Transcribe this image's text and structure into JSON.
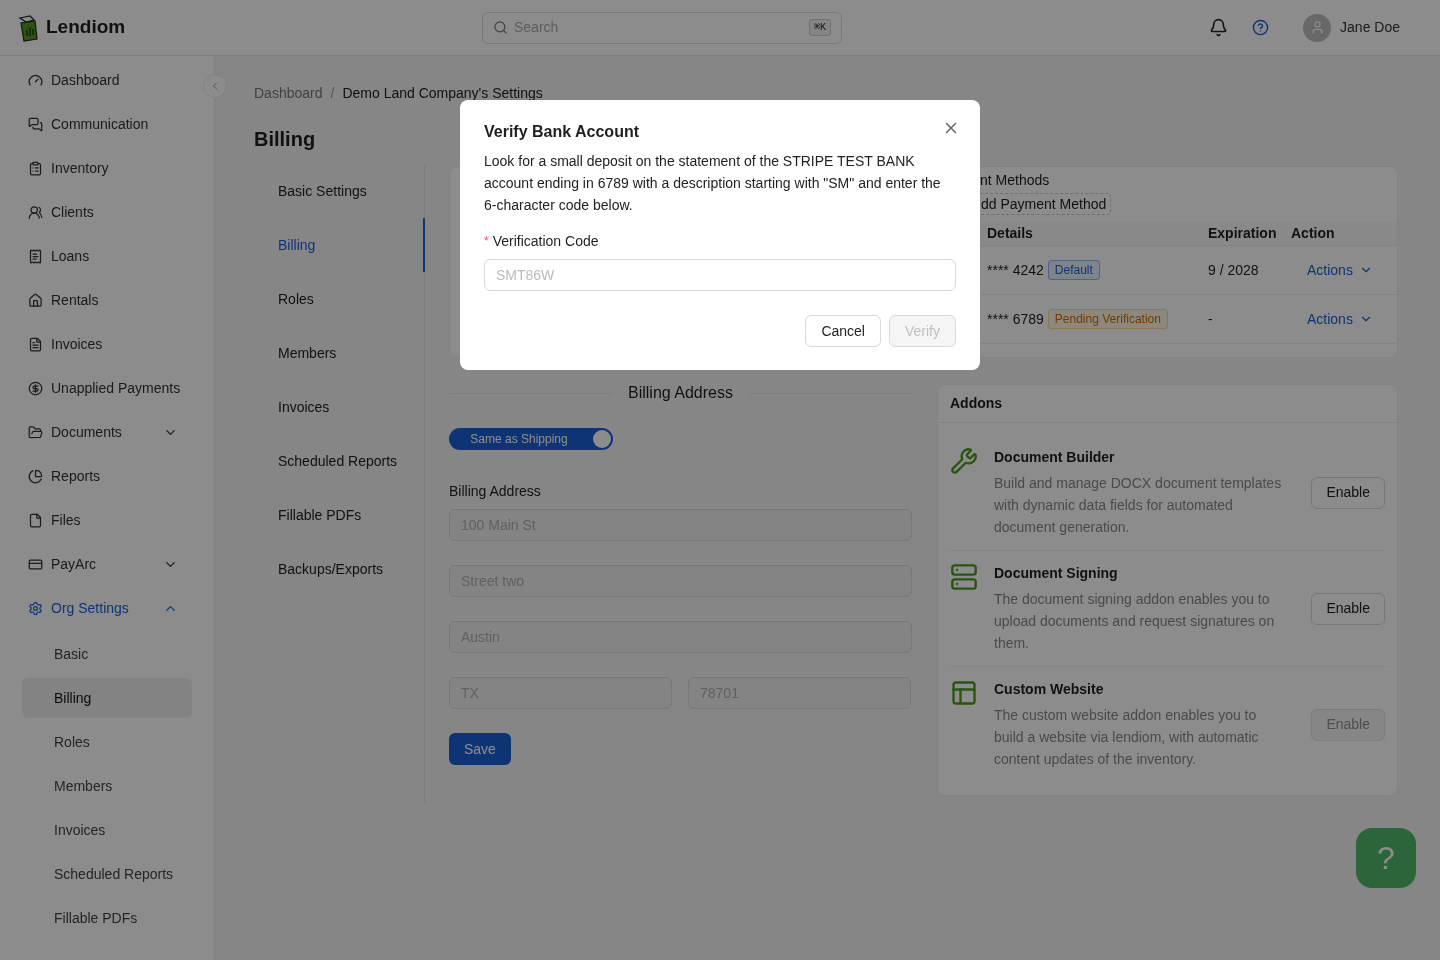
{
  "app": {
    "name": "Lendiom"
  },
  "header": {
    "search": {
      "placeholder": "Search",
      "shortcut": "⌘K"
    },
    "user": {
      "name": "Jane Doe"
    }
  },
  "sidebar": {
    "items": [
      {
        "label": "Dashboard",
        "kind": "link",
        "selected": false
      },
      {
        "label": "Communication",
        "kind": "link",
        "selected": false
      },
      {
        "label": "Inventory",
        "kind": "link",
        "selected": false
      },
      {
        "label": "Clients",
        "kind": "link",
        "selected": false
      },
      {
        "label": "Loans",
        "kind": "link",
        "selected": false
      },
      {
        "label": "Rentals",
        "kind": "link",
        "selected": false
      },
      {
        "label": "Invoices",
        "kind": "link",
        "selected": false
      },
      {
        "label": "Unapplied Payments",
        "kind": "link",
        "selected": false
      },
      {
        "label": "Documents",
        "kind": "group",
        "expanded": false,
        "selected": false
      },
      {
        "label": "Reports",
        "kind": "link",
        "selected": false
      },
      {
        "label": "Files",
        "kind": "link",
        "selected": false
      },
      {
        "label": "PayArc",
        "kind": "group",
        "expanded": false,
        "selected": false
      },
      {
        "label": "Org Settings",
        "kind": "group",
        "expanded": true,
        "selected": true,
        "children": [
          {
            "label": "Basic",
            "selected": false
          },
          {
            "label": "Billing",
            "selected": true
          },
          {
            "label": "Roles",
            "selected": false
          },
          {
            "label": "Members",
            "selected": false
          },
          {
            "label": "Invoices",
            "selected": false
          },
          {
            "label": "Scheduled Reports",
            "selected": false
          },
          {
            "label": "Fillable PDFs",
            "selected": false
          }
        ]
      }
    ]
  },
  "breadcrumb": {
    "separator": "/",
    "items": [
      "Dashboard",
      "Demo Land Company's Settings"
    ]
  },
  "page_title": "Billing",
  "settings_tabs": [
    {
      "label": "Basic Settings",
      "selected": false
    },
    {
      "label": "Billing",
      "selected": true
    },
    {
      "label": "Roles",
      "selected": false
    },
    {
      "label": "Members",
      "selected": false
    },
    {
      "label": "Invoices",
      "selected": false
    },
    {
      "label": "Scheduled Reports",
      "selected": false
    },
    {
      "label": "Fillable PDFs",
      "selected": false
    },
    {
      "label": "Backups/Exports",
      "selected": false
    }
  ],
  "payment_methods": {
    "title": "nt Methods",
    "add_button": "dd Payment Method",
    "columns": [
      "Details",
      "Expiration",
      "Action"
    ],
    "rows": [
      {
        "details": "**** 4242",
        "tag": {
          "label": "Default",
          "kind": "default"
        },
        "expiration": "9 / 2028",
        "action": "Actions"
      },
      {
        "details": "**** 6789",
        "tag": {
          "label": "Pending Verification",
          "kind": "pending"
        },
        "expiration": "-",
        "action": "Actions"
      }
    ]
  },
  "billing_address": {
    "heading": "Billing Address",
    "same_as_shipping": {
      "label": "Same as Shipping",
      "on": true
    },
    "label": "Billing Address",
    "fields": [
      {
        "value": "100 Main St",
        "disabled": true
      },
      {
        "value": "Street two",
        "disabled": true
      },
      {
        "value": "Austin",
        "disabled": true
      },
      {
        "value": "TX",
        "disabled": true
      },
      {
        "value": "78701",
        "disabled": true
      }
    ],
    "save_button": "Save"
  },
  "addons": {
    "title": "Addons",
    "items": [
      {
        "name": "Document Builder",
        "description": "Build and manage DOCX document templates with dynamic data fields for automated document generation.",
        "button": "Enable",
        "disabled": false
      },
      {
        "name": "Document Signing",
        "description": "The document signing addon enables you to upload documents and request signatures on them.",
        "button": "Enable",
        "disabled": false
      },
      {
        "name": "Custom Website",
        "description": "The custom website addon enables you to build a website via lendiom, with automatic content updates of the inventory.",
        "button": "Enable",
        "disabled": true
      }
    ]
  },
  "help_button": "?",
  "modal": {
    "title": "Verify Bank Account",
    "text": "Look for a small deposit on the statement of the STRIPE TEST BANK account ending in 6789 with a description starting with \"SM\" and enter the 6-character code below.",
    "field": {
      "label": "Verification Code",
      "required": true,
      "required_mark": "*",
      "placeholder": "SMT86W"
    },
    "buttons": [
      {
        "label": "Cancel",
        "kind": "secondary",
        "disabled": false
      },
      {
        "label": "Verify",
        "kind": "primary",
        "disabled": true
      }
    ]
  }
}
